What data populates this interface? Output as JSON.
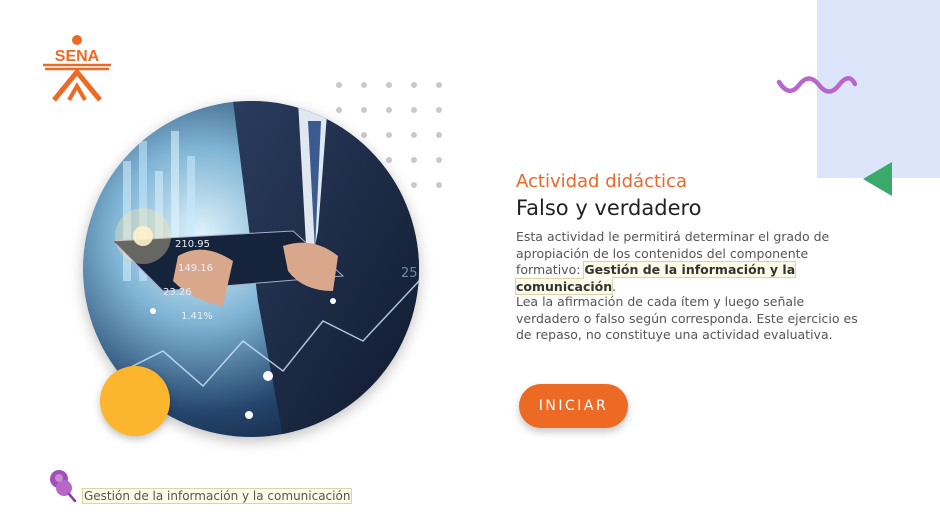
{
  "brand": {
    "logo_text": "SENA",
    "logo_color": "#ec6a23"
  },
  "hero": {
    "image_labels": [
      "210.95",
      "149.16",
      "23.26",
      "1.41%",
      "25"
    ]
  },
  "content": {
    "kicker": "Actividad didáctica",
    "title": "Falso y verdadero",
    "description_intro": "Esta actividad le permitirá determinar el grado de apropiación de los contenidos del componente formativo:",
    "description_highlight": "Gestión de la información y la comunicación",
    "description_end": ".",
    "instructions": "Lea la afirmación de cada ítem y luego señale verdadero o falso según corresponda.  Este ejercicio es de repaso, no constituye una actividad evaluativa."
  },
  "actions": {
    "start_label": "INICIAR"
  },
  "footer": {
    "label": "Gestión de la información y la comunicación"
  },
  "colors": {
    "accent": "#ec6a23",
    "yellow": "#fbb62d",
    "wave": "#b866c9",
    "triangle": "#3aaa6a",
    "panel": "#dde5fb"
  }
}
